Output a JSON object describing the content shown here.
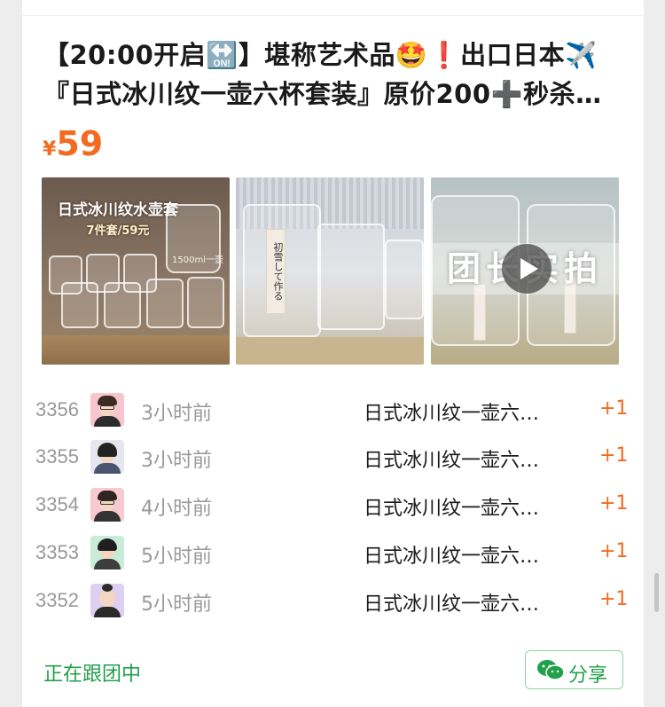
{
  "listing": {
    "title_line1": "【20:00开启🔛】堪称艺术品🤩❗出口日本✈️",
    "title_line2": "『日式冰川纹一壶六杯套装』原价200➕秒杀…",
    "price_currency": "¥",
    "price_value": "59"
  },
  "gallery": {
    "image1_banner": "日式冰川纹水壶套",
    "image1_subbanner": "7件套/59元",
    "image1_note": "1500ml一壶",
    "image2_label_a": "初雪して作る",
    "image3_overlay": "团长实拍"
  },
  "orders": [
    {
      "num": "3356",
      "time": "3小时前",
      "product": "日式冰川纹一壶六…",
      "qty": "+1",
      "avatar": "man-with-glasses"
    },
    {
      "num": "3355",
      "time": "3小时前",
      "product": "日式冰川纹一壶六…",
      "qty": "+1",
      "avatar": "woman-dark-hair"
    },
    {
      "num": "3354",
      "time": "4小时前",
      "product": "日式冰川纹一壶六…",
      "qty": "+1",
      "avatar": "man-glasses-pink"
    },
    {
      "num": "3353",
      "time": "5小时前",
      "product": "日式冰川纹一壶六…",
      "qty": "+1",
      "avatar": "woman-green"
    },
    {
      "num": "3352",
      "time": "5小时前",
      "product": "日式冰川纹一壶六…",
      "qty": "+1",
      "avatar": "woman-bun-purple"
    }
  ],
  "footer": {
    "status": "正在跟团中",
    "share_label": "分享"
  },
  "colors": {
    "accent_orange": "#f26b21",
    "accent_green": "#22a04a",
    "muted_text": "#999999"
  },
  "icons": {
    "share": "wechat-icon",
    "play": "play-icon"
  }
}
